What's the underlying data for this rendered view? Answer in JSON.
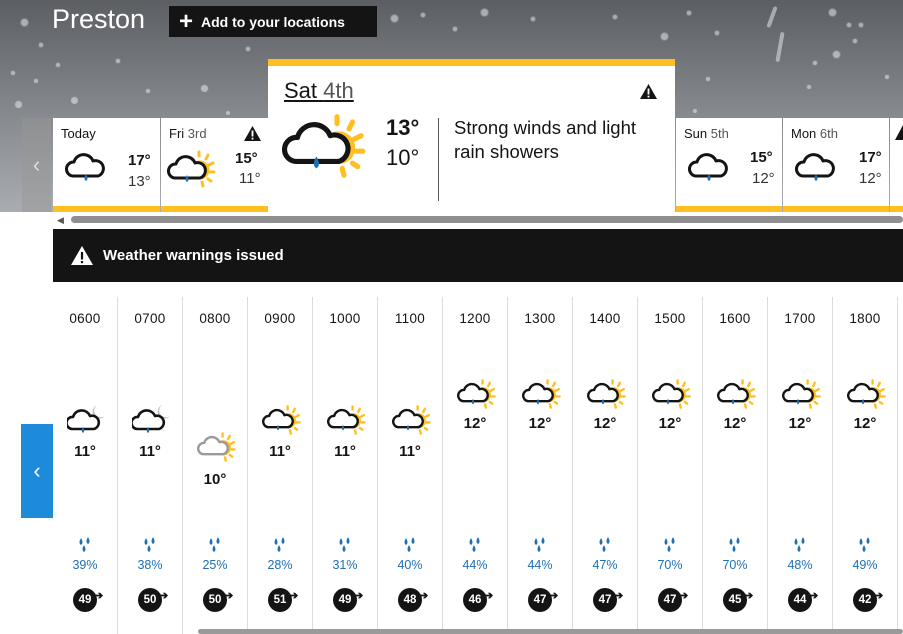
{
  "location": {
    "title": "Preston",
    "add_button_label": "Add to your locations"
  },
  "days": [
    {
      "label": "Today",
      "sub": "",
      "high": "17°",
      "low": "13°",
      "icon": "light-rain-cloud-icon",
      "warning": false
    },
    {
      "label": "Fri ",
      "sub": "3rd",
      "high": "15°",
      "low": "11°",
      "icon": "sunny-intervals-rain-icon",
      "warning": true
    },
    {
      "label": "Sun ",
      "sub": "5th",
      "high": "15°",
      "low": "12°",
      "icon": "light-rain-cloud-icon",
      "warning": false
    },
    {
      "label": "Mon ",
      "sub": "6th",
      "high": "17°",
      "low": "12°",
      "icon": "light-rain-cloud-icon",
      "warning": false
    }
  ],
  "selected_day": {
    "label": "Sat ",
    "sub": "4th",
    "high": "13°",
    "low": "10°",
    "description": "Strong winds and light rain showers",
    "icon": "sunny-intervals-rain-icon",
    "warning": true
  },
  "warning_banner": {
    "text": "Weather warnings issued"
  },
  "hourly": [
    {
      "time": "0600",
      "temp": "11°",
      "precip": "39%",
      "wind": "49",
      "icon": "night-rain-cloud-icon"
    },
    {
      "time": "0700",
      "temp": "11°",
      "precip": "38%",
      "wind": "50",
      "icon": "night-rain-cloud-icon"
    },
    {
      "time": "0800",
      "temp": "10°",
      "precip": "25%",
      "wind": "50",
      "icon": "sunny-intervals-icon"
    },
    {
      "time": "0900",
      "temp": "11°",
      "precip": "28%",
      "wind": "51",
      "icon": "sunny-intervals-rain-icon"
    },
    {
      "time": "1000",
      "temp": "11°",
      "precip": "31%",
      "wind": "49",
      "icon": "sunny-intervals-rain-icon"
    },
    {
      "time": "1100",
      "temp": "11°",
      "precip": "40%",
      "wind": "48",
      "icon": "sunny-intervals-rain-icon"
    },
    {
      "time": "1200",
      "temp": "12°",
      "precip": "44%",
      "wind": "46",
      "icon": "sunny-intervals-rain-icon"
    },
    {
      "time": "1300",
      "temp": "12°",
      "precip": "44%",
      "wind": "47",
      "icon": "sunny-intervals-rain-icon"
    },
    {
      "time": "1400",
      "temp": "12°",
      "precip": "47%",
      "wind": "47",
      "icon": "sunny-intervals-rain-icon"
    },
    {
      "time": "1500",
      "temp": "12°",
      "precip": "70%",
      "wind": "47",
      "icon": "sunny-intervals-rain-icon"
    },
    {
      "time": "1600",
      "temp": "12°",
      "precip": "70%",
      "wind": "45",
      "icon": "sunny-intervals-rain-icon"
    },
    {
      "time": "1700",
      "temp": "12°",
      "precip": "48%",
      "wind": "44",
      "icon": "sunny-intervals-rain-icon"
    },
    {
      "time": "1800",
      "temp": "12°",
      "precip": "49%",
      "wind": "42",
      "icon": "sunny-intervals-rain-icon"
    }
  ],
  "colors": {
    "accent": "#ffbf21",
    "dark": "#141414",
    "nav_blue": "#1d8bd9",
    "precip_blue": "#1f6fb5"
  }
}
